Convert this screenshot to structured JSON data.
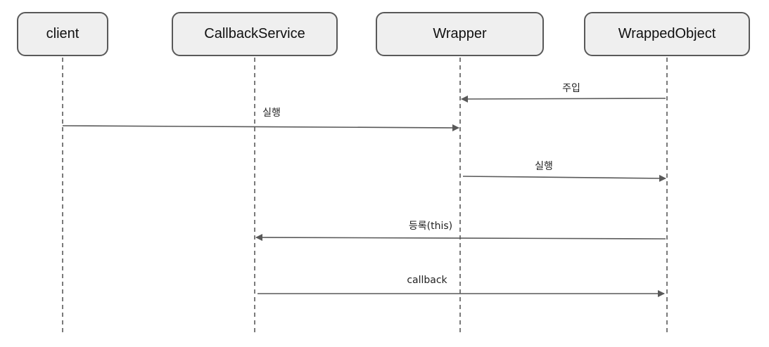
{
  "participants": [
    {
      "id": "client",
      "label": "client"
    },
    {
      "id": "callback-service",
      "label": "CallbackService"
    },
    {
      "id": "wrapper",
      "label": "Wrapper"
    },
    {
      "id": "wrapped-object",
      "label": "WrappedObject"
    }
  ],
  "messages": [
    {
      "from": "WrappedObject",
      "to": "Wrapper",
      "label": "주입"
    },
    {
      "from": "client",
      "to": "Wrapper",
      "label": "실행"
    },
    {
      "from": "Wrapper",
      "to": "WrappedObject",
      "label": "실행"
    },
    {
      "from": "WrappedObject",
      "to": "CallbackService",
      "label": "등록(this)"
    },
    {
      "from": "CallbackService",
      "to": "WrappedObject",
      "label": "callback"
    }
  ],
  "colors": {
    "box_fill": "#efefef",
    "box_border": "#595959",
    "line": "#595959"
  }
}
